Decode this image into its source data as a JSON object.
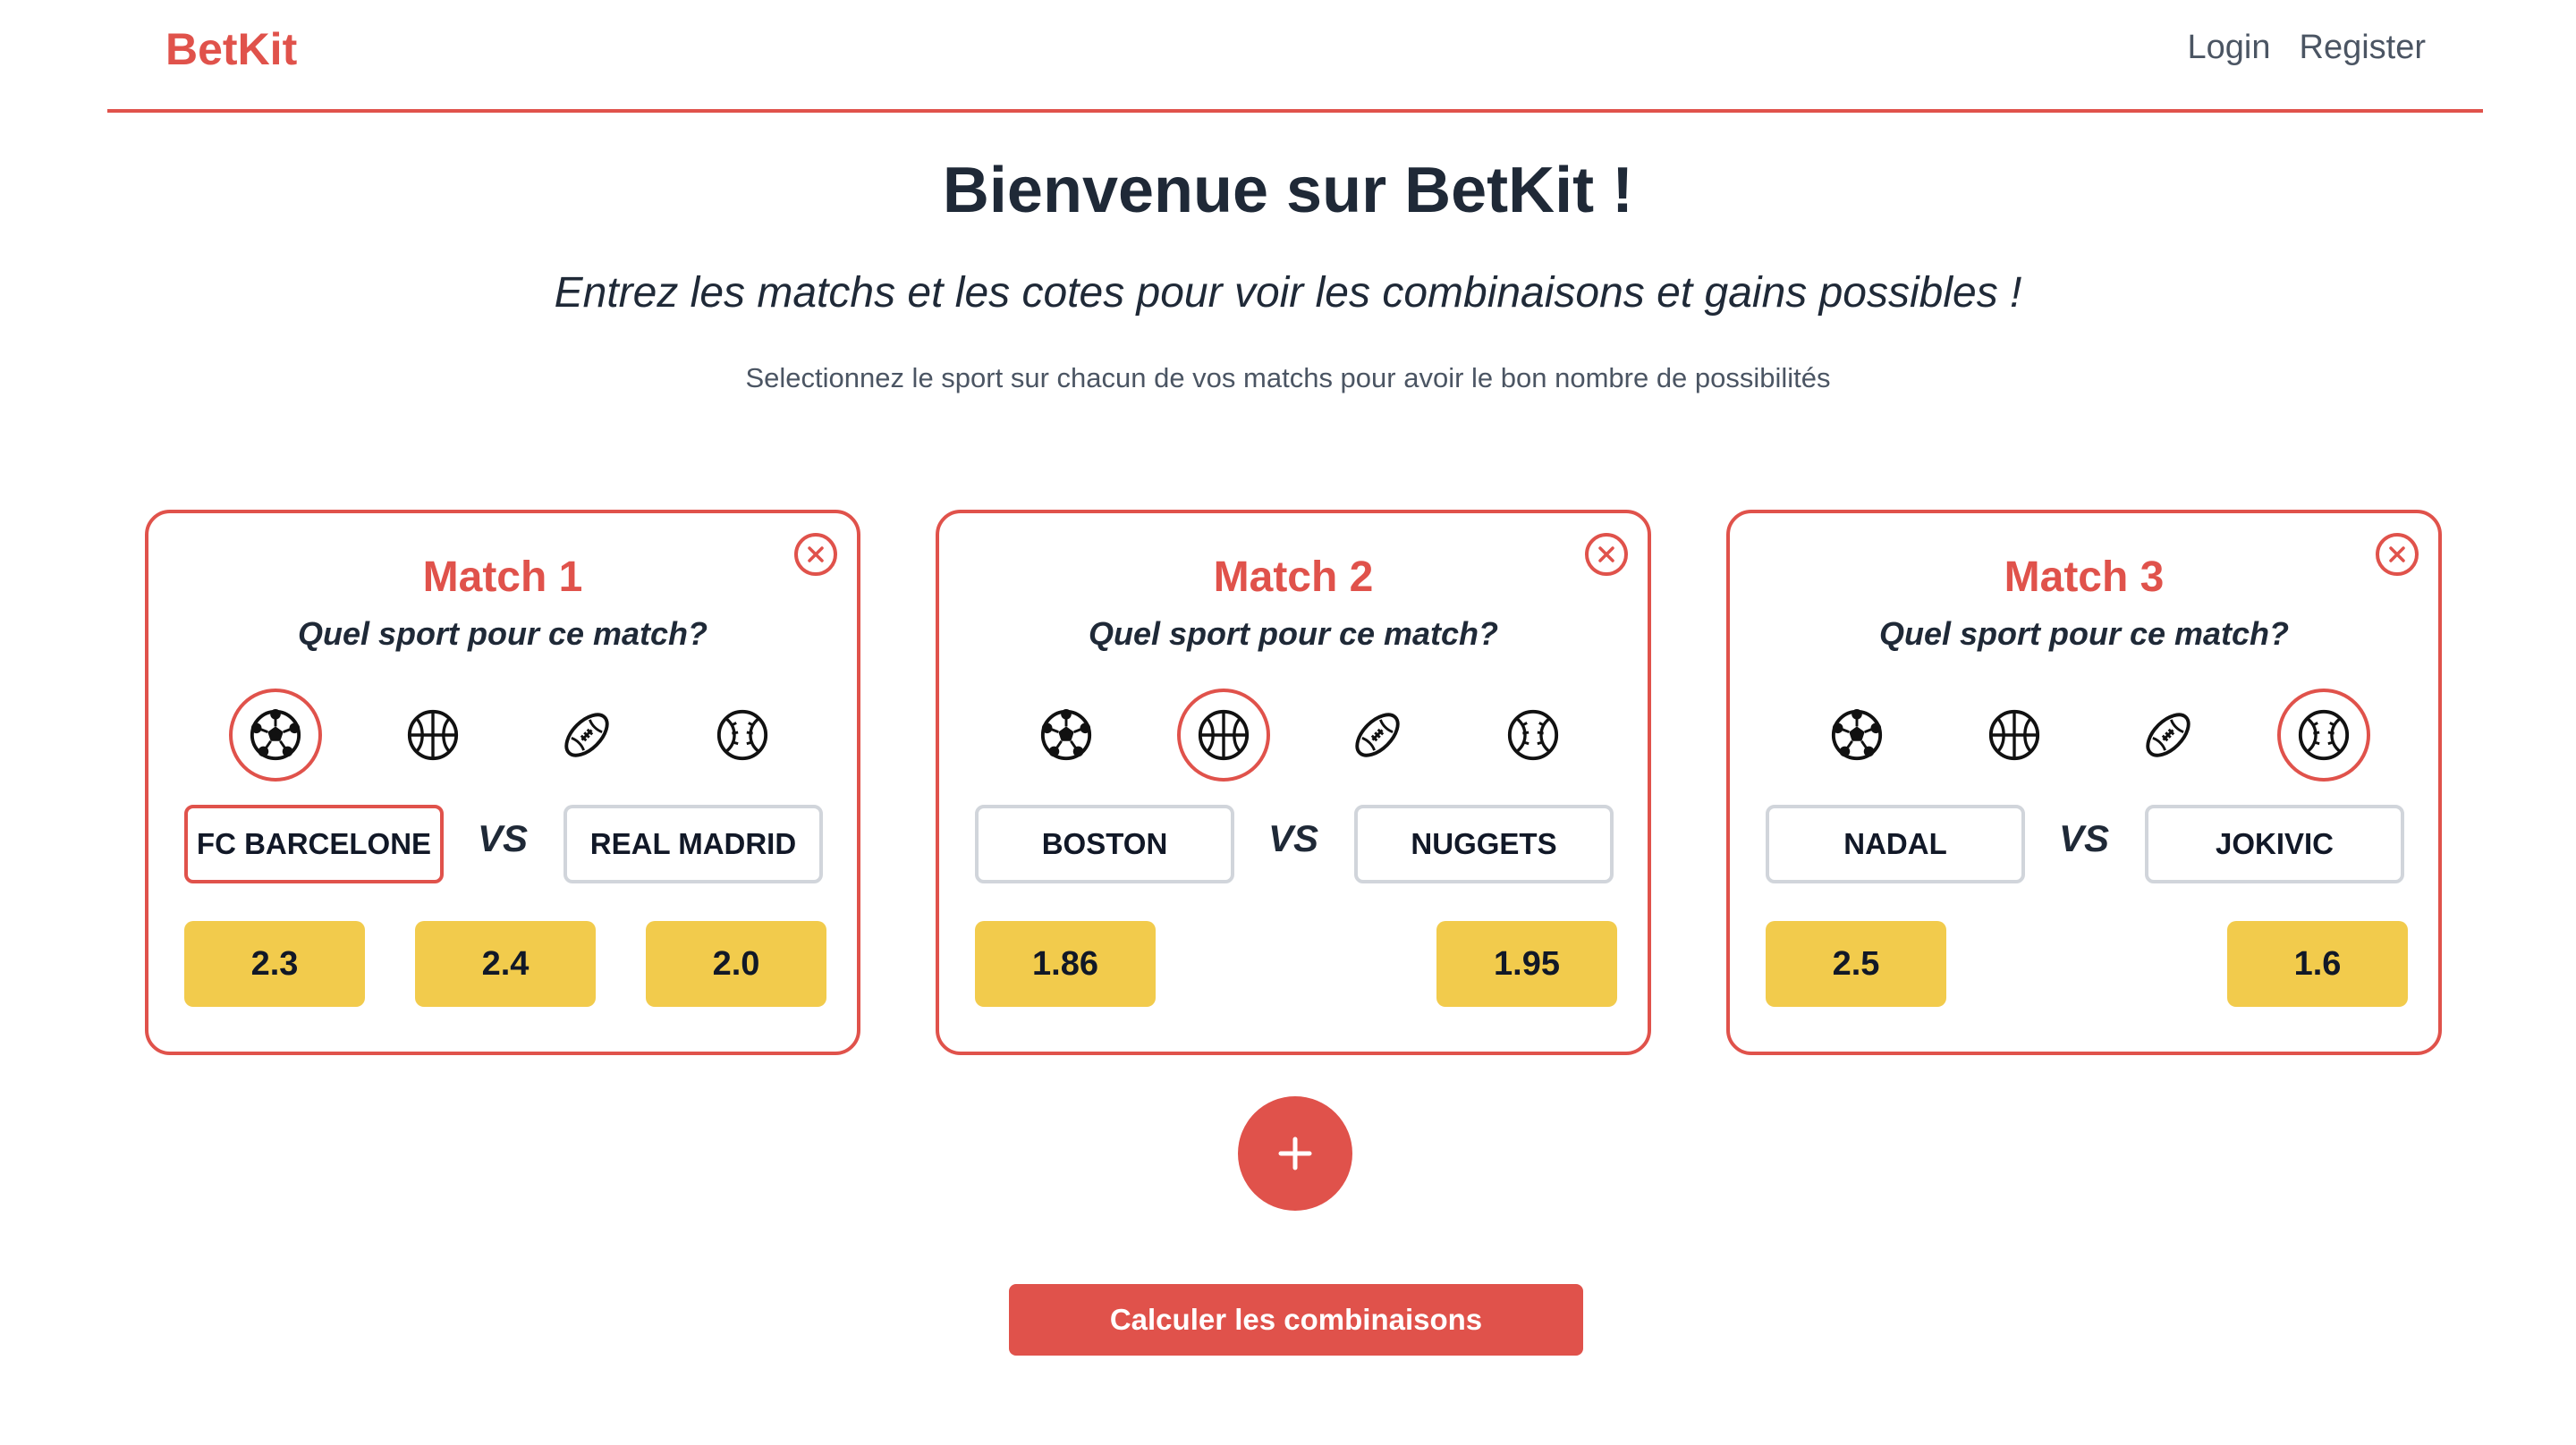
{
  "brand": "BetKit",
  "nav": {
    "login": "Login",
    "register": "Register"
  },
  "hero": {
    "title": "Bienvenue sur BetKit !",
    "subtitle": "Entrez les matchs et les cotes pour voir les combinaisons et gains possibles !",
    "hint": "Selectionnez le sport sur chacun de vos matchs pour avoir le bon nombre de possibilités"
  },
  "question": "Quel sport pour ce match?",
  "vs_label": "VS",
  "sport_icons": [
    "soccer-ball-icon",
    "basketball-icon",
    "american-football-icon",
    "tennis-ball-icon"
  ],
  "matches": [
    {
      "title": "Match 1",
      "selected_sport": "soccer-ball-icon",
      "team1": "FC BARCELONE",
      "team2": "REAL MADRID",
      "odds": [
        "2.3",
        "2.4",
        "2.0"
      ]
    },
    {
      "title": "Match 2",
      "selected_sport": "basketball-icon",
      "team1": "BOSTON",
      "team2": "NUGGETS",
      "odds": [
        "1.86",
        "1.95"
      ]
    },
    {
      "title": "Match 3",
      "selected_sport": "tennis-ball-icon",
      "team1": "NADAL",
      "team2": "JOKIVIC",
      "odds": [
        "2.5",
        "1.6"
      ]
    }
  ],
  "add_icon": "plus-icon",
  "calculate_label": "Calculer les combinaisons",
  "colors": {
    "accent": "#e0524b",
    "odds": "#f2cb4c",
    "text": "#1f2937"
  }
}
